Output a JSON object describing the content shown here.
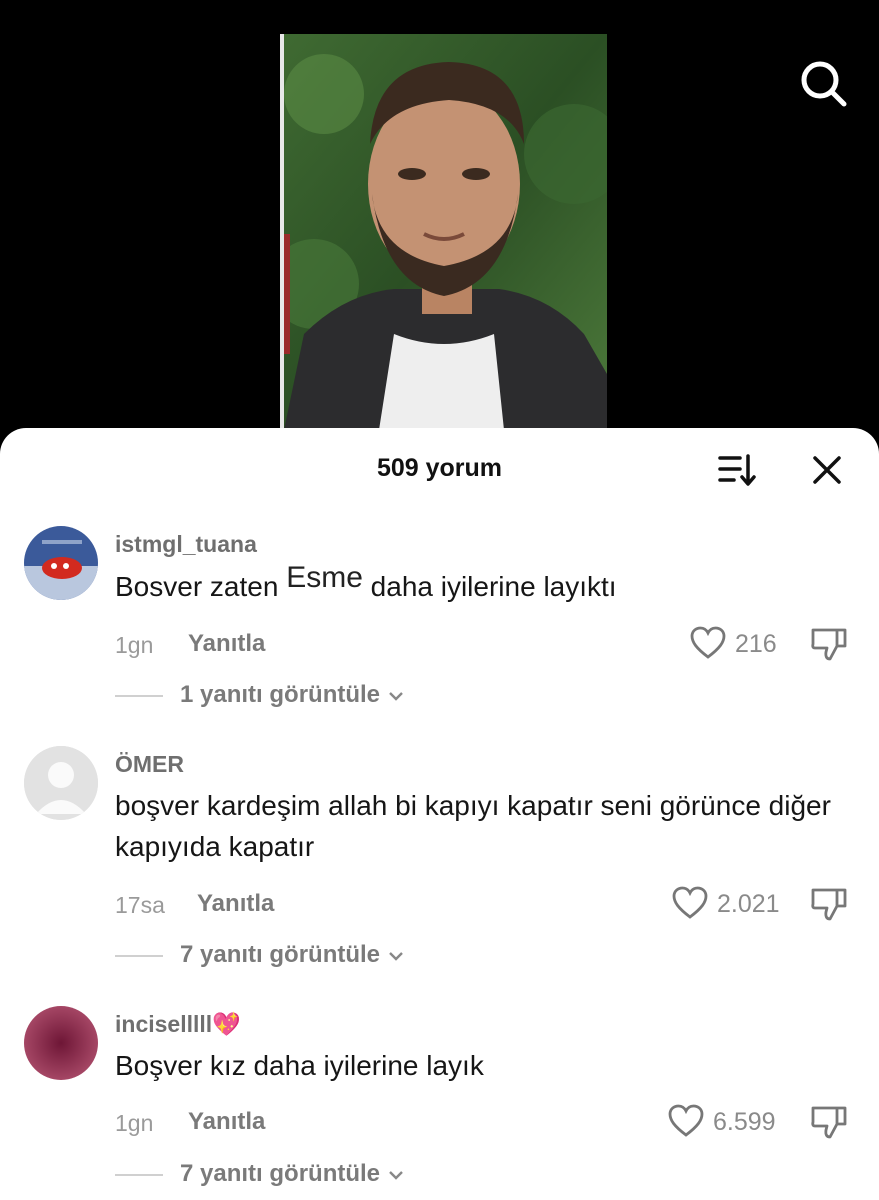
{
  "header": {
    "title": "509 yorum"
  },
  "comments": [
    {
      "username": "istmgl_tuana",
      "text_before": "Bosver zaten",
      "text_inserted": "Esme",
      "text_after": "daha iyilerine layıktı",
      "time": "1gn",
      "reply_label": "Yanıtla",
      "likes": "216",
      "view_replies": "1 yanıtı görüntüle"
    },
    {
      "username": "ÖMER",
      "text": "boşver kardeşim allah bi kapıyı kapatır seni görünce diğer kapıyıda kapatır",
      "time": "17sa",
      "reply_label": "Yanıtla",
      "likes": "2.021",
      "view_replies": "7 yanıtı görüntüle"
    },
    {
      "username": "inciselllll",
      "username_emoji": "💖",
      "text": "Boşver kız daha iyilerine layık",
      "time": "1gn",
      "reply_label": "Yanıtla",
      "likes": "6.599",
      "view_replies": "7 yanıtı görüntüle"
    }
  ],
  "icons": {
    "search": "search-icon",
    "sort": "sort-icon",
    "close": "close-icon",
    "like": "heart-icon",
    "dislike": "thumbs-down-icon",
    "expand": "chevron-down-icon"
  },
  "colors": {
    "sheet": "#ffffff",
    "video_bg": "#000000",
    "username": "#6f6f6f",
    "muted": "#9a9a9a"
  }
}
